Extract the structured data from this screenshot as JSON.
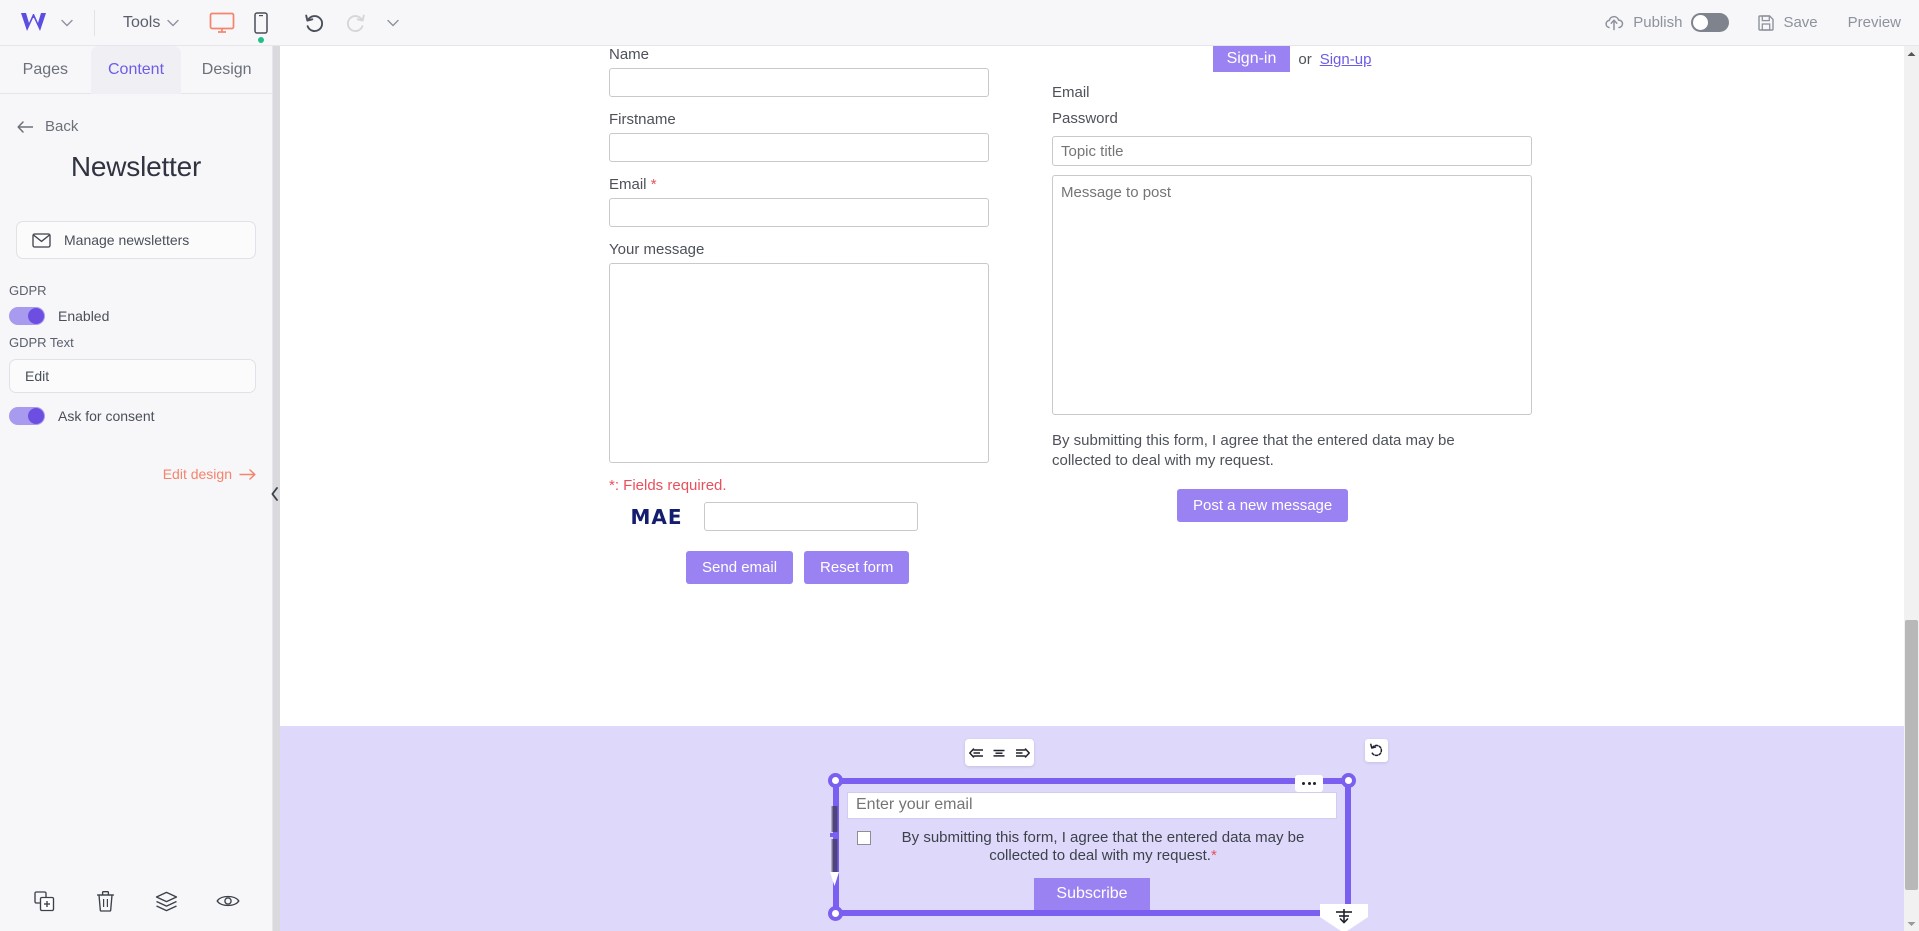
{
  "topbar": {
    "logo_name": "w-logo",
    "tools_label": "Tools",
    "publish_label": "Publish",
    "save_label": "Save",
    "preview_label": "Preview",
    "accent_purple": "#6c5ce7",
    "device_desktop_color": "#f4846c",
    "device_mobile_color": "#4a4f59",
    "status_dot_color": "#1fc08a"
  },
  "sidebar": {
    "tabs": [
      {
        "label": "Pages",
        "active": false
      },
      {
        "label": "Content",
        "active": true
      },
      {
        "label": "Design",
        "active": false
      }
    ],
    "back_label": "Back",
    "title": "Newsletter",
    "manage_button": "Manage newsletters",
    "gdpr_section_label": "GDPR",
    "gdpr_enabled_label": "Enabled",
    "gdpr_text_label": "GDPR Text",
    "gdpr_edit_label": "Edit",
    "ask_consent_label": "Ask for consent",
    "edit_design_label": "Edit design",
    "footer_icons": [
      "duplicate-icon",
      "trash-icon",
      "layers-icon",
      "eye-icon"
    ]
  },
  "contact_form": {
    "name_label": "Name",
    "firstname_label": "Firstname",
    "email_label": "Email",
    "email_required_mark": "*",
    "message_label": "Your message",
    "fields_required_note": "*: Fields required.",
    "captcha_text": "MAE",
    "send_button": "Send email",
    "reset_button": "Reset form"
  },
  "forum_form": {
    "signin_tab": "Sign-in",
    "or_text": "or",
    "signup_link": "Sign-up",
    "email_label": "Email",
    "password_label": "Password",
    "topic_placeholder": "Topic title",
    "message_placeholder": "Message to post",
    "gdpr_note": "By submitting this form, I agree that the entered data may be collected to deal with my request.",
    "post_button": "Post a new message"
  },
  "newsletter_widget": {
    "email_placeholder": "Enter your email",
    "consent_text": "By submitting this form, I agree that the entered data may be collected to deal with my request.",
    "consent_required_mark": "*",
    "subscribe_button": "Subscribe",
    "selection_color": "#7b5ff0",
    "background_color": "#ded9fb",
    "toolbar_icons": [
      "align-left-icon",
      "align-center-icon",
      "align-right-icon"
    ],
    "rotate_icon": "rotate-reset-icon",
    "more_icon": "more-options-icon"
  }
}
